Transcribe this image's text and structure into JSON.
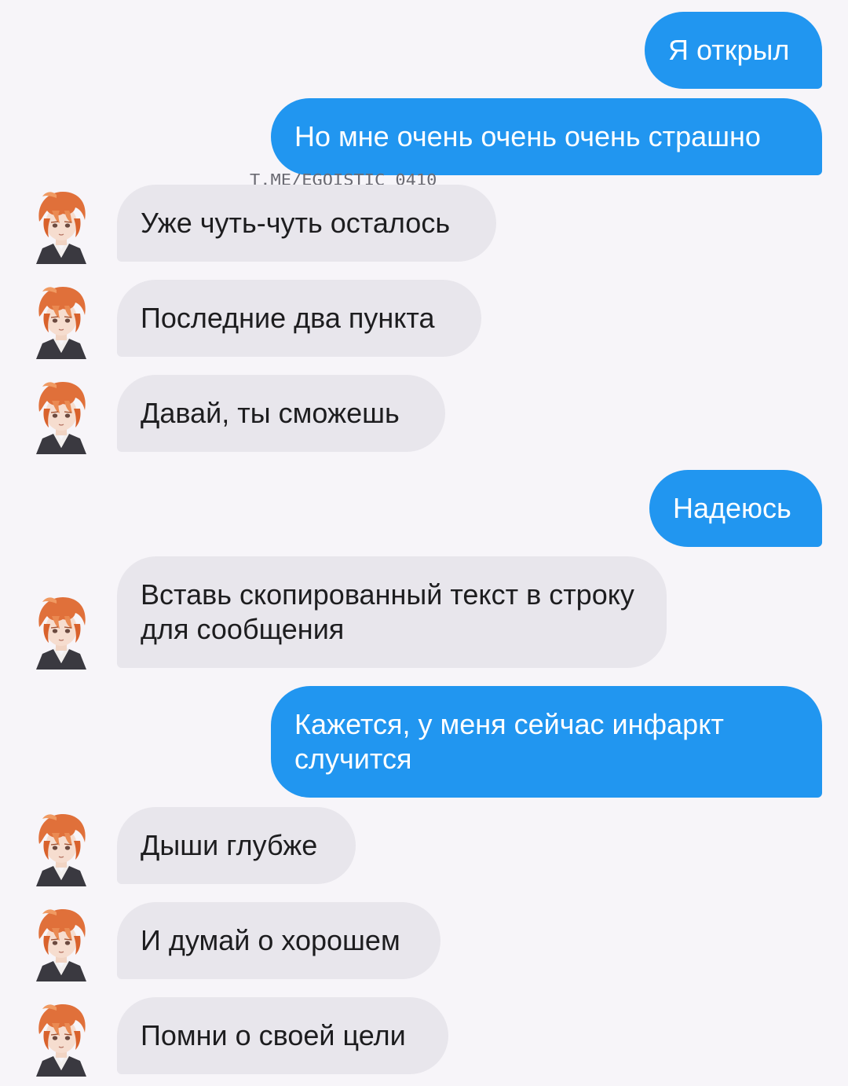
{
  "watermark": "T.ME/EGOISTIC_0410",
  "messages": [
    {
      "id": "m1",
      "side": "out",
      "text": "Я открыл"
    },
    {
      "id": "m2",
      "side": "out",
      "text": "Но мне очень очень очень страшно"
    },
    {
      "id": "m3",
      "side": "in",
      "text": "Уже чуть-чуть осталось"
    },
    {
      "id": "m4",
      "side": "in",
      "text": "Последние два пункта"
    },
    {
      "id": "m5",
      "side": "in",
      "text": "Давай, ты сможешь"
    },
    {
      "id": "m6",
      "side": "out",
      "text": "Надеюсь"
    },
    {
      "id": "m7",
      "side": "in",
      "text": "Вставь скопированный текст в строку для сообщения"
    },
    {
      "id": "m8",
      "side": "out",
      "text": "Кажется, у меня сейчас инфаркт случится"
    },
    {
      "id": "m9",
      "side": "in",
      "text": "Дыши глубже"
    },
    {
      "id": "m10",
      "side": "in",
      "text": "И думай о хорошем"
    },
    {
      "id": "m11",
      "side": "in",
      "text": "Помни о своей цели"
    }
  ],
  "avatar": {
    "icon": "anime-boy-avatar-icon",
    "hair_color": "#e0703a"
  }
}
